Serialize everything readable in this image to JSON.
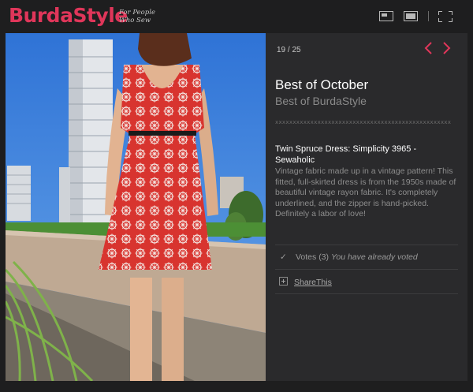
{
  "header": {
    "logo": "BurdaStyle",
    "tagline_line1": "For People",
    "tagline_line2": "Who Sew",
    "view_buttons": [
      "small-view-icon",
      "large-view-icon",
      "fullscreen-icon"
    ]
  },
  "photo": {
    "description_icon": "photo-image",
    "dress_color": "#d8342f"
  },
  "panel": {
    "counter": "19 / 25",
    "prev_icon": "chevron-left-icon",
    "next_icon": "chevron-right-icon",
    "title": "Best of October",
    "subtitle": "Best of BurdaStyle",
    "divider": "xxxxxxxxxxxxxxxxxxxxxxxxxxxxxxxxxxxxxxxxxxxxxxxxxx",
    "item_title": "Twin Spruce Dress: Simplicity 3965 - Sewaholic",
    "item_description": "Vintage fabric made up in a vintage pattern! This fitted, full-skirted dress is from the 1950s made of beautiful vintage rayon fabric. It's completely underlined, and the zipper is hand-picked. Definitely a labor of love!",
    "votes_label": "Votes (3)",
    "votes_status": "You have already voted",
    "share_label": "ShareThis"
  },
  "colors": {
    "brand": "#e0365a",
    "background": "#1e1e1f",
    "panel": "#2a2a2c"
  }
}
